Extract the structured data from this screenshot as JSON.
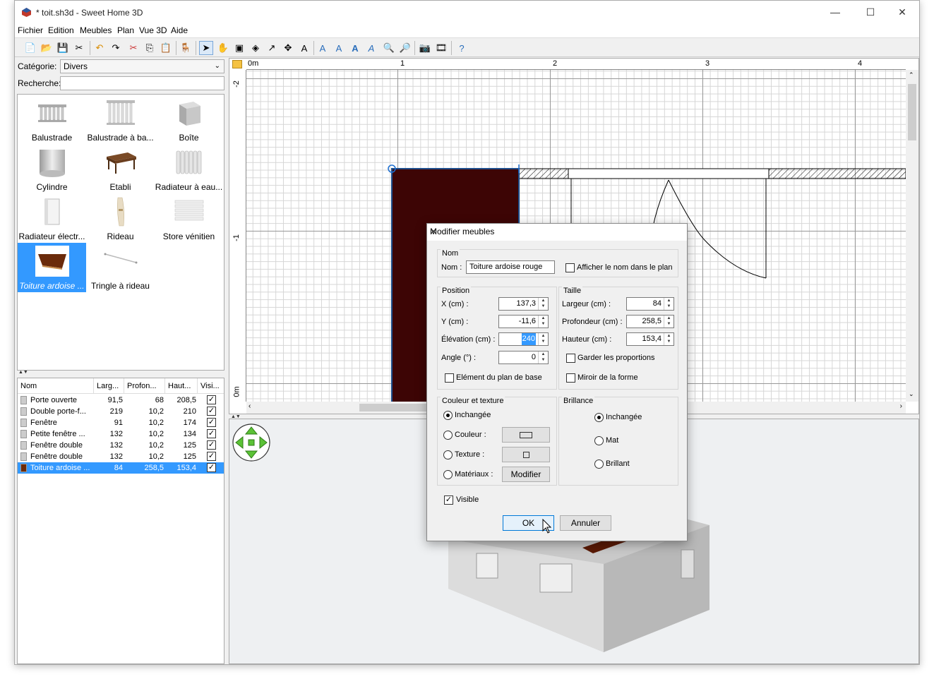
{
  "window": {
    "title": "* toit.sh3d - Sweet Home 3D",
    "minimize": "—",
    "maximize": "☐",
    "close": "✕"
  },
  "menu": [
    "Fichier",
    "Edition",
    "Meubles",
    "Plan",
    "Vue 3D",
    "Aide"
  ],
  "catalog": {
    "category_label": "Catégorie:",
    "category_value": "Divers",
    "search_label": "Recherche:",
    "search_value": "",
    "items": [
      {
        "label": "Balustrade",
        "icon": "balustrade-icon"
      },
      {
        "label": "Balustrade à ba...",
        "icon": "balustrade-icon"
      },
      {
        "label": "Boîte",
        "icon": "box-icon"
      },
      {
        "label": "Cylindre",
        "icon": "cylinder-icon"
      },
      {
        "label": "Etabli",
        "icon": "workbench-icon"
      },
      {
        "label": "Radiateur à eau...",
        "icon": "radiator-icon"
      },
      {
        "label": "Radiateur électr...",
        "icon": "electric-radiator-icon"
      },
      {
        "label": "Rideau",
        "icon": "curtain-icon"
      },
      {
        "label": "Store vénitien",
        "icon": "blind-icon"
      },
      {
        "label": "Toiture ardoise ...",
        "icon": "roof-icon",
        "selected": true
      },
      {
        "label": "Tringle à rideau",
        "icon": "curtain-rod-icon"
      }
    ]
  },
  "furniture_table": {
    "columns": [
      "Nom",
      "Larg...",
      "Profon...",
      "Haut...",
      "Visi..."
    ],
    "rows": [
      {
        "name": "Porte ouverte",
        "width": "91,5",
        "depth": "68",
        "height": "208,5",
        "visible": true
      },
      {
        "name": "Double porte-f...",
        "width": "219",
        "depth": "10,2",
        "height": "210",
        "visible": true
      },
      {
        "name": "Fenêtre",
        "width": "91",
        "depth": "10,2",
        "height": "174",
        "visible": true
      },
      {
        "name": "Petite fenêtre ...",
        "width": "132",
        "depth": "10,2",
        "height": "134",
        "visible": true
      },
      {
        "name": "Fenêtre double",
        "width": "132",
        "depth": "10,2",
        "height": "125",
        "visible": true
      },
      {
        "name": "Fenêtre double",
        "width": "132",
        "depth": "10,2",
        "height": "125",
        "visible": true
      },
      {
        "name": "Toiture ardoise ...",
        "width": "84",
        "depth": "258,5",
        "height": "153,4",
        "visible": true,
        "selected": true
      }
    ]
  },
  "plan": {
    "ruler_x": [
      "0m",
      "1",
      "2",
      "3",
      "4"
    ],
    "ruler_y": [
      "-2",
      "-1",
      "0m"
    ]
  },
  "dialog": {
    "title": "Modifier meubles",
    "name_group": "Nom",
    "name_label": "Nom :",
    "name_value": "Toiture ardoise rouge",
    "show_name_label": "Afficher le nom dans le plan",
    "position_group": "Position",
    "x_label": "X (cm) :",
    "x_value": "137,3",
    "y_label": "Y (cm) :",
    "y_value": "-11,6",
    "elevation_label": "Élévation (cm) :",
    "elevation_value": "240",
    "angle_label": "Angle (°) :",
    "angle_value": "0",
    "base_plan_label": "Elément du plan de base",
    "size_group": "Taille",
    "width_label": "Largeur (cm) :",
    "width_value": "84",
    "depth_label": "Profondeur (cm) :",
    "depth_value": "258,5",
    "height_label": "Hauteur (cm) :",
    "height_value": "153,4",
    "keep_proportions_label": "Garder les proportions",
    "mirror_label": "Miroir de la forme",
    "color_group": "Couleur et texture",
    "unchanged_label": "Inchangée",
    "color_label": "Couleur :",
    "texture_label": "Texture :",
    "materials_label": "Matériaux :",
    "modify_label": "Modifier",
    "shininess_group": "Brillance",
    "shine_unchanged_label": "Inchangée",
    "matte_label": "Mat",
    "shiny_label": "Brillant",
    "visible_label": "Visible",
    "ok_label": "OK",
    "cancel_label": "Annuler"
  },
  "colors": {
    "selection": "#3399ff",
    "roof": "#3d0505"
  }
}
